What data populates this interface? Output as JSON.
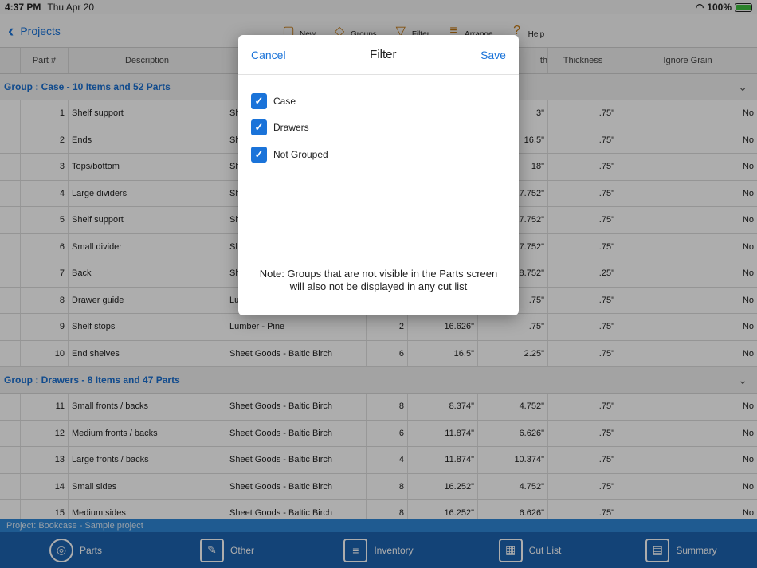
{
  "status": {
    "time": "4:37 PM",
    "date": "Thu Apr 20",
    "battery": "100%"
  },
  "nav": {
    "back_label": "Projects",
    "tools": [
      {
        "label": "New",
        "icon": "new-doc-icon"
      },
      {
        "label": "Groups",
        "icon": "groups-icon"
      },
      {
        "label": "Filter",
        "icon": "filter-icon"
      },
      {
        "label": "Arrange",
        "icon": "arrange-icon"
      },
      {
        "label": "Help",
        "icon": "help-icon"
      }
    ]
  },
  "table": {
    "headers": [
      "",
      "Part #",
      "Description",
      "",
      "",
      "",
      "th",
      "Thickness",
      "Ignore Grain"
    ],
    "group1": "Group : Case - 10 Items and 52 Parts",
    "group2": "Group : Drawers - 8 Items and 47 Parts",
    "rows1": [
      [
        "1",
        "Shelf support",
        "Sh",
        "",
        "",
        "3\"",
        ".75\"",
        "No"
      ],
      [
        "2",
        "Ends",
        "Sh",
        "",
        "",
        "16.5\"",
        ".75\"",
        "No"
      ],
      [
        "3",
        "Tops/bottom",
        "Sh",
        "",
        "",
        "18\"",
        ".75\"",
        "No"
      ],
      [
        "4",
        "Large dividers",
        "Sh",
        "",
        "",
        "17.752\"",
        ".75\"",
        "No"
      ],
      [
        "5",
        "Shelf support",
        "Sh",
        "",
        "",
        "17.752\"",
        ".75\"",
        "No"
      ],
      [
        "6",
        "Small divider",
        "Sh",
        "",
        "",
        "17.752\"",
        ".75\"",
        "No"
      ],
      [
        "7",
        "Back",
        "Sh",
        "",
        "",
        "28.752\"",
        ".25\"",
        "No"
      ],
      [
        "8",
        "Drawer guide",
        "Lu",
        "",
        "",
        ".75\"",
        ".75\"",
        "No"
      ],
      [
        "9",
        "Shelf stops",
        "Lumber - Pine",
        "2",
        "16.626\"",
        ".75\"",
        ".75\"",
        "No"
      ],
      [
        "10",
        "End shelves",
        "Sheet Goods - Baltic Birch",
        "6",
        "16.5\"",
        "2.25\"",
        ".75\"",
        "No"
      ]
    ],
    "rows2": [
      [
        "11",
        "Small fronts / backs",
        "Sheet Goods - Baltic Birch",
        "8",
        "8.374\"",
        "4.752\"",
        ".75\"",
        "No"
      ],
      [
        "12",
        "Medium fronts / backs",
        "Sheet Goods - Baltic Birch",
        "6",
        "11.874\"",
        "6.626\"",
        ".75\"",
        "No"
      ],
      [
        "13",
        "Large fronts / backs",
        "Sheet Goods - Baltic Birch",
        "4",
        "11.874\"",
        "10.374\"",
        ".75\"",
        "No"
      ],
      [
        "14",
        "Small sides",
        "Sheet Goods - Baltic Birch",
        "8",
        "16.252\"",
        "4.752\"",
        ".75\"",
        "No"
      ],
      [
        "15",
        "Medium sides",
        "Sheet Goods - Baltic Birch",
        "8",
        "16.252\"",
        "6.626\"",
        ".75\"",
        "No"
      ]
    ]
  },
  "project_bar": "Project: Bookcase - Sample project",
  "tabs": [
    {
      "label": "Parts",
      "icon": "tape-measure-icon"
    },
    {
      "label": "Other",
      "icon": "ruler-icon"
    },
    {
      "label": "Inventory",
      "icon": "lumber-stack-icon"
    },
    {
      "label": "Cut List",
      "icon": "cut-list-icon"
    },
    {
      "label": "Summary",
      "icon": "summary-doc-icon"
    }
  ],
  "modal": {
    "title": "Filter",
    "cancel": "Cancel",
    "save": "Save",
    "options": [
      {
        "label": "Case",
        "checked": true
      },
      {
        "label": "Drawers",
        "checked": true
      },
      {
        "label": "Not Grouped",
        "checked": true
      }
    ],
    "note_line1": "Note: Groups that are not visible in the Parts screen",
    "note_line2": "will also not be displayed in any cut list"
  },
  "colors": {
    "accent": "#1a73d9",
    "tabbar": "#1d63b0",
    "projectbar": "#2e86d6"
  }
}
